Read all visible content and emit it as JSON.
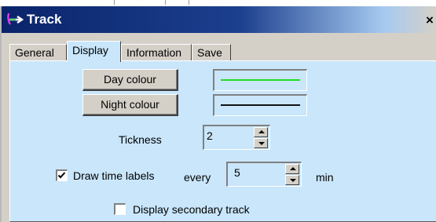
{
  "window": {
    "title": "Track",
    "close_glyph": "×"
  },
  "tabs": [
    {
      "label": "General",
      "active": false
    },
    {
      "label": "Display",
      "active": true
    },
    {
      "label": "Information",
      "active": false
    },
    {
      "label": "Save",
      "active": false
    }
  ],
  "display": {
    "day_colour_label": "Day colour",
    "day_colour": "#22dd22",
    "night_colour_label": "Night colour",
    "night_colour": "#111111",
    "thickness_label": "Tickness",
    "thickness_value": "2",
    "draw_time_labels": {
      "label": "Draw time labels",
      "checked": true
    },
    "every_label": "every",
    "interval_value": "5",
    "unit_label": "min",
    "secondary_track": {
      "label": "Display secondary track",
      "checked": false
    }
  },
  "colors": {
    "titlebar": "#0a246a",
    "panel": "#c9e6fb",
    "window": "#d4d0c8"
  },
  "icons": {
    "app": "track-arrow-icon",
    "close": "close-icon"
  }
}
